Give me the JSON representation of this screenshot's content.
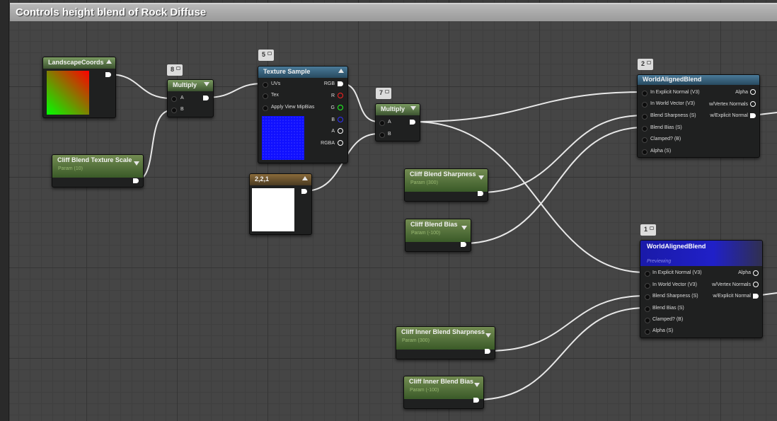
{
  "comment": {
    "title": "Controls height blend of Rock Diffuse"
  },
  "nodes": {
    "landscape_coords": {
      "title": "LandscapeCoords"
    },
    "multiply_a": {
      "title": "Multiply",
      "badge": "8",
      "pins": [
        "A",
        "B"
      ]
    },
    "texture_sample": {
      "title": "Texture Sample",
      "badge": "5",
      "inputs": [
        "UVs",
        "Tex",
        "Apply View MipBias"
      ],
      "outputs": [
        "RGB",
        "R",
        "G",
        "B",
        "A",
        "RGBA"
      ]
    },
    "cliff_blend_texture_scale": {
      "title": "Cliff Blend Texture Scale",
      "subtitle": "Param (10)"
    },
    "constant_3vec": {
      "title": "2,2,1"
    },
    "multiply_b": {
      "title": "Multiply",
      "badge": "7",
      "pins": [
        "A",
        "B"
      ]
    },
    "cliff_blend_sharpness": {
      "title": "Cliff Blend Sharpness",
      "subtitle": "Param (300)"
    },
    "cliff_blend_bias": {
      "title": "Cliff Blend Bias",
      "subtitle": "Param (-100)"
    },
    "world_aligned_blend_top": {
      "title": "WorldAlignedBlend",
      "badge": "2",
      "inputs": [
        "In Explicit Normal (V3)",
        "In World Vector (V3)",
        "Blend Sharpness (S)",
        "Blend Bias (S)",
        "Clamped? (B)",
        "Alpha (S)"
      ],
      "outputs": [
        "Alpha",
        "w/Vertex Normals",
        "w/Explicit Normal"
      ]
    },
    "world_aligned_blend_bottom": {
      "title": "WorldAlignedBlend",
      "badge": "1",
      "status": "Previewing",
      "inputs": [
        "In Explicit Normal (V3)",
        "In World Vector (V3)",
        "Blend Sharpness (S)",
        "Blend Bias (S)",
        "Clamped? (B)",
        "Alpha (S)"
      ],
      "outputs": [
        "Alpha",
        "w/Vertex Normals",
        "w/Explicit Normal"
      ]
    },
    "cliff_inner_blend_sharpness": {
      "title": "Cliff Inner Blend Sharpness",
      "subtitle": "Param (300)"
    },
    "cliff_inner_blend_bias": {
      "title": "Cliff Inner Blend Bias",
      "subtitle": "Param (-100)"
    }
  },
  "colors": {
    "wire": "#e8e8e8",
    "param_header": "#5f7d43",
    "texture_header": "#3a6a8a",
    "preview_blue": "#1010ff"
  }
}
